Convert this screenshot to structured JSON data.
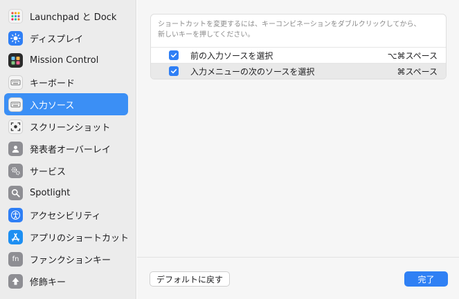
{
  "sidebar": {
    "items": [
      {
        "label": "Launchpad と Dock",
        "icon": "launchpad-icon"
      },
      {
        "label": "ディスプレイ",
        "icon": "display-icon"
      },
      {
        "label": "Mission Control",
        "icon": "mission-control-icon"
      },
      {
        "label": "キーボード",
        "icon": "keyboard-icon"
      },
      {
        "label": "入力ソース",
        "icon": "input-source-icon",
        "active": true
      },
      {
        "label": "スクリーンショット",
        "icon": "screenshot-icon"
      },
      {
        "label": "発表者オーバーレイ",
        "icon": "presenter-overlay-icon"
      },
      {
        "label": "サービス",
        "icon": "services-gear-icon"
      },
      {
        "label": "Spotlight",
        "icon": "spotlight-search-icon"
      },
      {
        "label": "アクセシビリティ",
        "icon": "accessibility-icon"
      },
      {
        "label": "アプリのショートカット",
        "icon": "app-store-icon"
      },
      {
        "label": "ファンクションキー",
        "icon": "fn-key-icon"
      },
      {
        "label": "修飾キー",
        "icon": "modifier-key-icon"
      }
    ]
  },
  "main": {
    "note_line1": "ショートカットを変更するには、キーコンビネーションをダブルクリックしてから、",
    "note_line2": "新しいキーを押してください。",
    "shortcuts": [
      {
        "label": "前の入力ソースを選択",
        "key": "⌥⌘スペース",
        "checked": true
      },
      {
        "label": "入力メニューの次のソースを選択",
        "key": "⌘スペース",
        "checked": true
      }
    ],
    "default_button": "デフォルトに戻す",
    "done_button": "完了"
  },
  "colors": {
    "accent": "#3b8ff5",
    "sidebar_bg": "#ececec"
  }
}
